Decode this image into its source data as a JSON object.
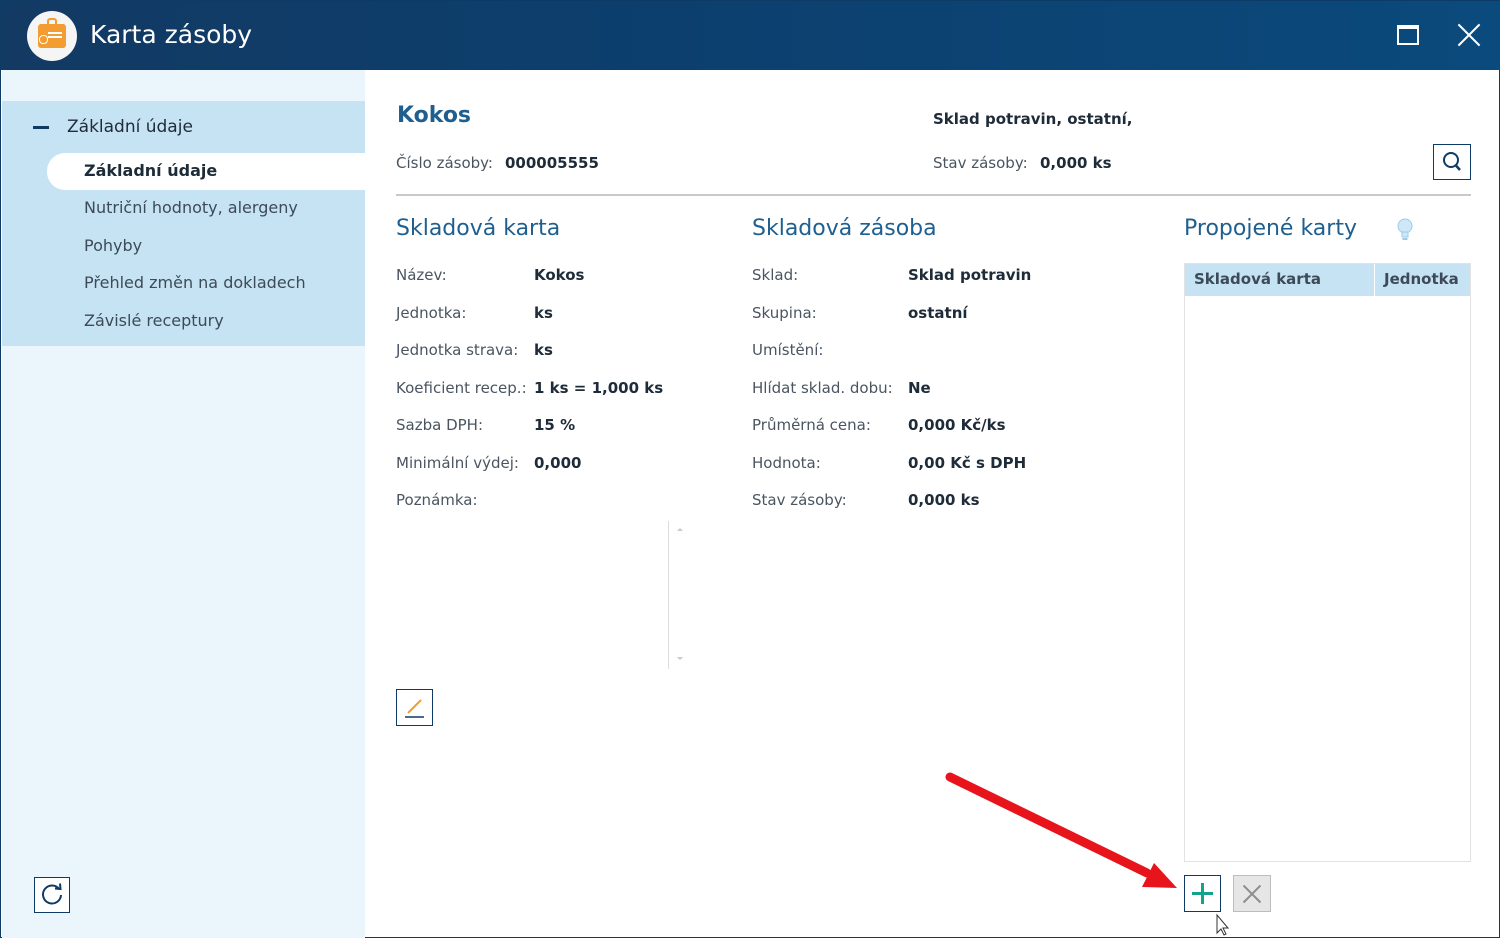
{
  "window": {
    "title": "Karta zásoby",
    "accent_color": "#0d3b66",
    "title_color": "#1f5f8f",
    "icons": [
      "app-bag-icon",
      "maximize-icon",
      "close-icon"
    ]
  },
  "sidebar": {
    "group_label": "Základní údaje",
    "items": [
      {
        "label": "Základní údaje",
        "active": true
      },
      {
        "label": "Nutriční hodnoty, alergeny"
      },
      {
        "label": "Pohyby"
      },
      {
        "label": "Přehled změn na dokladech"
      },
      {
        "label": "Závislé receptury"
      }
    ],
    "refresh_icon": "refresh-icon"
  },
  "header": {
    "product_name": "Kokos",
    "location": "Sklad potravin, ostatní,",
    "number_label": "Číslo zásoby:",
    "number_value": "000005555",
    "stock_label": "Stav zásoby:",
    "stock_value": "0,000 ks",
    "search_icon": "search-icon"
  },
  "card": {
    "title": "Skladová karta",
    "fields": [
      {
        "label": "Název:",
        "value": "Kokos"
      },
      {
        "label": "Jednotka:",
        "value": "ks"
      },
      {
        "label": "Jednotka strava:",
        "value": "ks"
      },
      {
        "label": "Koeficient recep.:",
        "value": "1 ks = 1,000 ks"
      },
      {
        "label": "Sazba DPH:",
        "value": "15 %"
      },
      {
        "label": "Minimální výdej:",
        "value": "0,000"
      },
      {
        "label": "Poznámka:",
        "value": ""
      }
    ],
    "edit_icon": "edit-icon"
  },
  "stock": {
    "title": "Skladová zásoba",
    "fields": [
      {
        "label": "Sklad:",
        "value": "Sklad potravin"
      },
      {
        "label": "Skupina:",
        "value": "ostatní"
      },
      {
        "label": "Umístění:",
        "value": ""
      },
      {
        "label": "Hlídat sklad. dobu:",
        "value": "Ne"
      },
      {
        "label": "Průměrná cena:",
        "value": "0,000 Kč/ks"
      },
      {
        "label": "Hodnota:",
        "value": "0,00 Kč s DPH"
      },
      {
        "label": "Stav zásoby:",
        "value": "0,000 ks"
      }
    ]
  },
  "linked": {
    "title": "Propojené karty",
    "hint_icon": "lightbulb-icon",
    "columns": [
      "Skladová karta",
      "Jednotka"
    ],
    "add_icon": "plus-icon",
    "delete_icon": "delete-x-icon",
    "annotation_color": "#e8141b"
  }
}
